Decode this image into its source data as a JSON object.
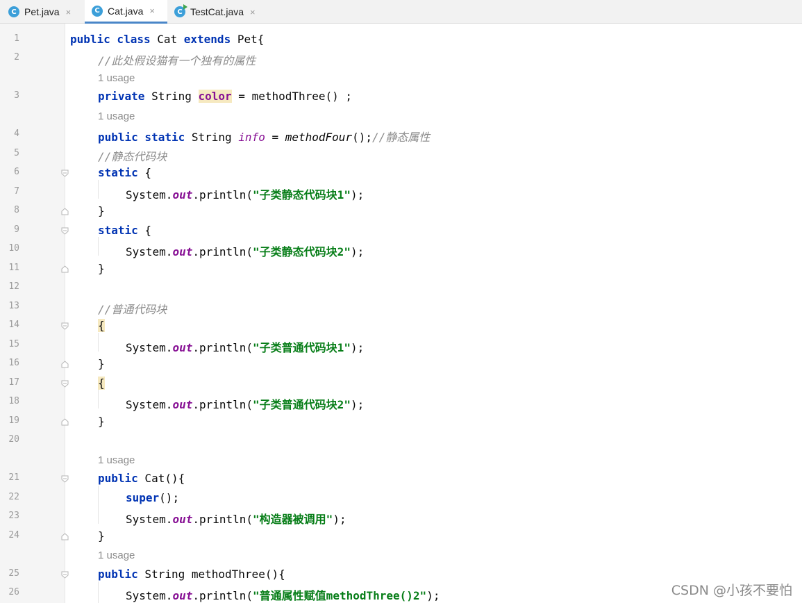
{
  "tabs": [
    {
      "label": "Pet.java",
      "icon": "java-class-icon",
      "close": "×"
    },
    {
      "label": "Cat.java",
      "icon": "java-class-icon",
      "close": "×"
    },
    {
      "label": "TestCat.java",
      "icon": "java-runnable-class-icon",
      "close": "×"
    }
  ],
  "active_tab": "Cat.java",
  "file_icon_letter": "C",
  "usage_hint": "1 usage",
  "lines": {
    "l1": {
      "n": "1",
      "kw1": "public class",
      "t1": " Cat ",
      "kw2": "extends",
      "t2": " Pet{"
    },
    "l2": {
      "n": "2",
      "cm": "//此处假设猫有一个独有的属性"
    },
    "l3": {
      "n": "3",
      "kw": "private",
      "t1": " String ",
      "hl": "color",
      "t2": " = methodThree() ;"
    },
    "l4": {
      "n": "4",
      "kw": "public static",
      "t1": " String ",
      "fld": "info",
      "t2": " = ",
      "it": "methodFour",
      "t3": "();",
      "cm": "//静态属性"
    },
    "l5": {
      "n": "5",
      "cm": "//静态代码块"
    },
    "l6": {
      "n": "6",
      "kw": "static",
      "t1": " {"
    },
    "l7": {
      "n": "7",
      "t1": "System.",
      "sf": "out",
      "t2": ".println(",
      "str": "\"子类静态代码块1\"",
      "t3": ");"
    },
    "l8": {
      "n": "8",
      "t1": "}"
    },
    "l9": {
      "n": "9",
      "kw": "static",
      "t1": " {"
    },
    "l10": {
      "n": "10",
      "t1": "System.",
      "sf": "out",
      "t2": ".println(",
      "str": "\"子类静态代码块2\"",
      "t3": ");"
    },
    "l11": {
      "n": "11",
      "t1": "}"
    },
    "l12": {
      "n": "12"
    },
    "l13": {
      "n": "13",
      "cm": "//普通代码块"
    },
    "l14": {
      "n": "14",
      "hl": "{"
    },
    "l15": {
      "n": "15",
      "t1": "System.",
      "sf": "out",
      "t2": ".println(",
      "str": "\"子类普通代码块1\"",
      "t3": ");"
    },
    "l16": {
      "n": "16",
      "t1": "}"
    },
    "l17": {
      "n": "17",
      "hl": "{"
    },
    "l18": {
      "n": "18",
      "t1": "System.",
      "sf": "out",
      "t2": ".println(",
      "str": "\"子类普通代码块2\"",
      "t3": ");"
    },
    "l19": {
      "n": "19",
      "t1": "}"
    },
    "l20": {
      "n": "20"
    },
    "l21": {
      "n": "21",
      "kw": "public",
      "t1": " Cat(){"
    },
    "l22": {
      "n": "22",
      "kw": "super",
      "t1": "();"
    },
    "l23": {
      "n": "23",
      "t1": "System.",
      "sf": "out",
      "t2": ".println(",
      "str": "\"构造器被调用\"",
      "t3": ");"
    },
    "l24": {
      "n": "24",
      "t1": "}"
    },
    "l25": {
      "n": "25",
      "kw": "public",
      "t1": " String methodThree(){"
    },
    "l26": {
      "n": "26",
      "t1": "System.",
      "sf": "out",
      "t2": ".println(",
      "str": "\"普通属性赋值methodThree()2\"",
      "t3": ");"
    }
  },
  "watermark": "CSDN @小孩不要怕",
  "colors": {
    "keyword": "#0033b3",
    "string": "#067d17",
    "comment": "#8c8c8c",
    "static_field": "#871094",
    "tab_underline": "#4a86c8"
  }
}
